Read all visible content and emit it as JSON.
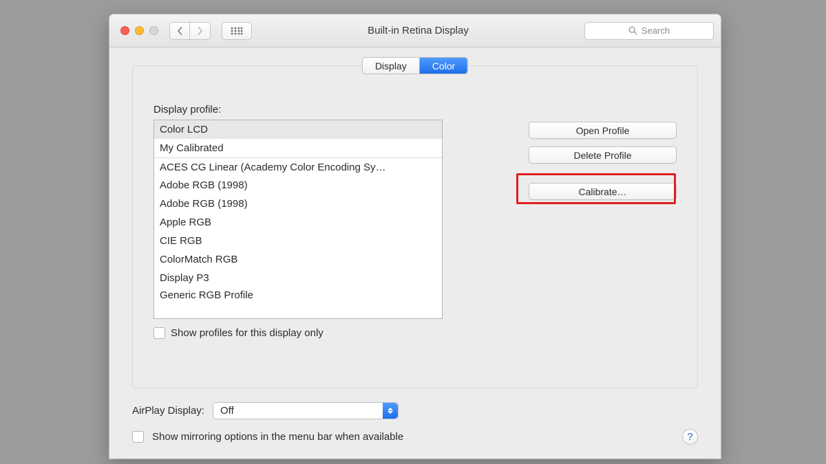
{
  "window": {
    "title": "Built-in Retina Display"
  },
  "toolbar": {
    "search_placeholder": "Search"
  },
  "tabs": [
    "Display",
    "Color"
  ],
  "active_tab_index": 1,
  "profile_section": {
    "label": "Display profile:",
    "items": [
      "Color LCD",
      "My Calibrated",
      "ACES CG Linear (Academy Color Encoding Sy…",
      "Adobe RGB (1998)",
      "Adobe RGB (1998)",
      "Apple RGB",
      "CIE RGB",
      "ColorMatch RGB",
      "Display P3",
      "Generic RGB Profile"
    ],
    "selected_index": 0,
    "show_only_label": "Show profiles for this display only"
  },
  "actions": {
    "open_profile": "Open Profile",
    "delete_profile": "Delete Profile",
    "calibrate": "Calibrate…"
  },
  "airplay": {
    "label": "AirPlay Display:",
    "value": "Off"
  },
  "mirroring_label": "Show mirroring options in the menu bar when available",
  "help_glyph": "?"
}
